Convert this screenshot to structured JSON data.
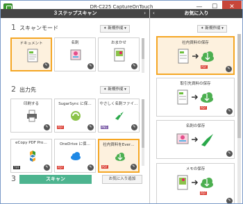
{
  "window": {
    "title": "DR-C225 CaptureOnTouch",
    "minimize": "—",
    "maximize": "☐",
    "close": "✕"
  },
  "left_panel": {
    "header": "３ステップスキャン",
    "collapse_glyph": "›",
    "new_label": "✦ 新規作成 ▾",
    "step1": {
      "number": "1",
      "title": "スキャンモード",
      "cards": [
        {
          "label": "ドキュメント",
          "selected": true
        },
        {
          "label": "名刺",
          "selected": false
        },
        {
          "label": "おまかせ",
          "selected": false
        }
      ]
    },
    "step2": {
      "number": "2",
      "title": "出力先",
      "row1": [
        {
          "label": "印刷する",
          "badge": ""
        },
        {
          "label": "SugarSync に保…",
          "badge": "PDF"
        },
        {
          "label": "やさしく名刺ファイ…",
          "badge": "PNG"
        }
      ],
      "row2": [
        {
          "label": "eCopy PDF Pro…",
          "badge": "TIFF"
        },
        {
          "label": "OneDrive に保…",
          "badge": "PDF"
        },
        {
          "label": "社内資料をEver…",
          "badge": "PDF",
          "selected": true
        }
      ]
    },
    "step3": {
      "number": "3",
      "scan_button": "スキャン",
      "favorite_add": "お気に入り追加"
    }
  },
  "right_panel": {
    "header": "お気に入り",
    "collapse_glyph": "‹",
    "new_label": "✦ 新規作成 ▾",
    "cards": [
      {
        "label": "社内資料の保存",
        "selected": true,
        "badge": "PDF"
      },
      {
        "label": "取引先資料の保存",
        "selected": false,
        "badge": "PDF"
      },
      {
        "label": "名刺の保存",
        "selected": false,
        "badge": ""
      },
      {
        "label": "メモの保存",
        "selected": false,
        "badge": "PDF"
      }
    ]
  },
  "colors": {
    "header_bg": "#454545",
    "selection_border": "#f5a623",
    "scan_button": "#4db48f",
    "pdf_badge": "#d9352a"
  }
}
